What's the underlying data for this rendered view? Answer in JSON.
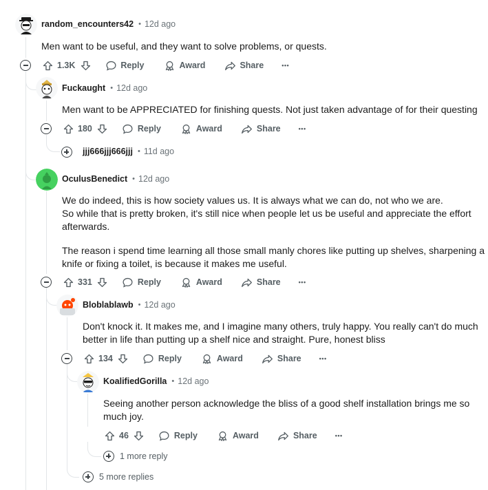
{
  "comments": [
    {
      "username": "random_encounters42",
      "time": "12d ago",
      "lines": [
        "Men want to be useful, and they want to solve problems, or quests."
      ],
      "votes": "1.3K"
    },
    {
      "username": "Fuckaught",
      "time": "12d ago",
      "lines": [
        "Men want to be APPRECIATED for finishing quests. Not just taken advantage of for their questing"
      ],
      "votes": "180"
    },
    {
      "username": "jjj666jjj666jjj",
      "time": "11d ago"
    },
    {
      "username": "OculusBenedict",
      "time": "12d ago",
      "lines": [
        "We do indeed, this is how society values us. It is always what we can do, not who we are.",
        "So while that is pretty broken, it's still nice when people let us be useful and appreciate the effort",
        "afterwards.",
        "The reason i spend time learning all those small manly chores like putting up shelves, sharpening a",
        "knife or fixing a toilet, is because it makes me useful."
      ],
      "votes": "331"
    },
    {
      "username": "Bloblablawb",
      "time": "12d ago",
      "lines": [
        "Don't knock it. It makes me, and I imagine many others, truly happy. You really can't do much",
        "better in life than putting up a shelf nice and straight. Pure, honest bliss"
      ],
      "votes": "134"
    },
    {
      "username": "KoalifiedGorilla",
      "time": "12d ago",
      "lines": [
        "Seeing another person acknowledge the bliss of a good shelf installation brings me so",
        "much joy."
      ],
      "votes": "46"
    }
  ],
  "actions": {
    "reply": "Reply",
    "award": "Award",
    "share": "Share",
    "more": "•••"
  },
  "more_replies": {
    "koala": "1 more reply",
    "blob": "5 more replies"
  },
  "colors": {
    "meta": "#6b7378",
    "action": "#555e63",
    "thread": "#e2e5e8",
    "avatar_green": "#46d160",
    "avatar_red": "#ff4500"
  }
}
